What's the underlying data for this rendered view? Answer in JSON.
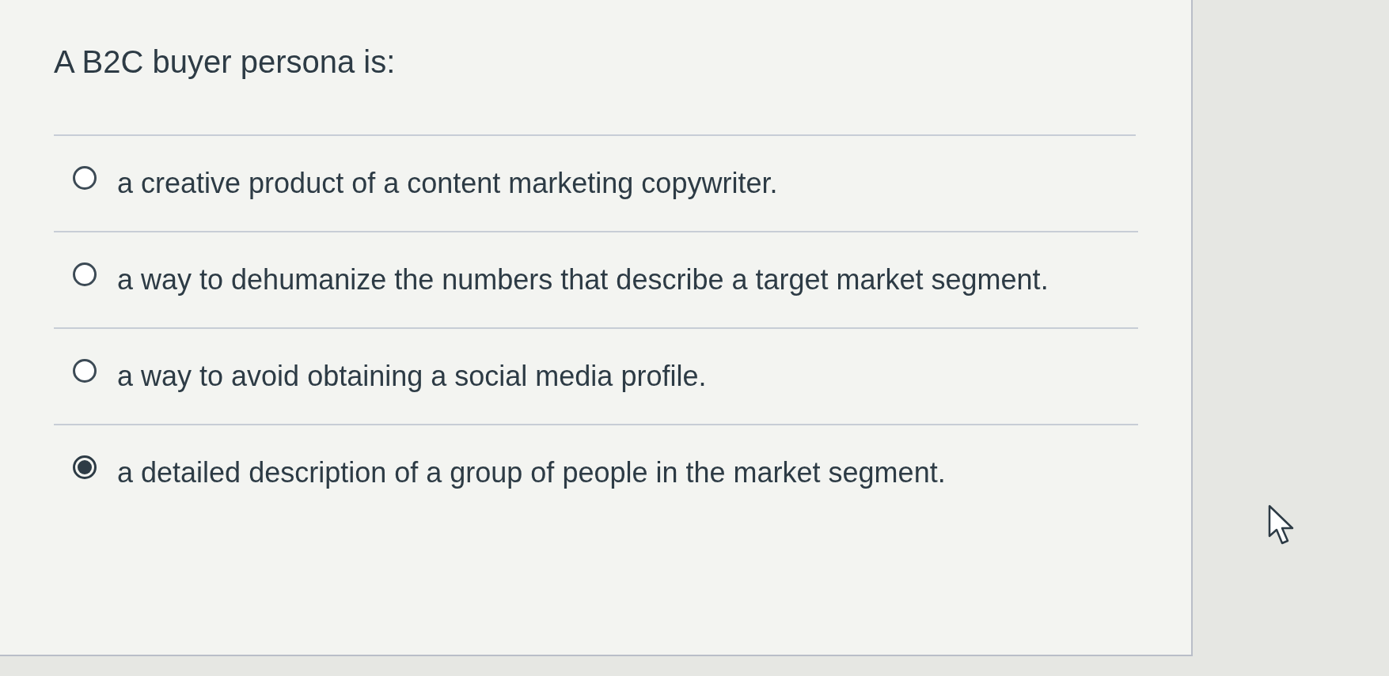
{
  "question": "A B2C buyer persona is:",
  "options": [
    {
      "text": "a creative product of a content marketing copywriter.",
      "selected": false
    },
    {
      "text": "a way to dehumanize the numbers that describe a target market segment.",
      "selected": false
    },
    {
      "text": "a way to avoid obtaining a social media profile.",
      "selected": false
    },
    {
      "text": "a detailed description of a group of people in the market segment.",
      "selected": true
    }
  ]
}
